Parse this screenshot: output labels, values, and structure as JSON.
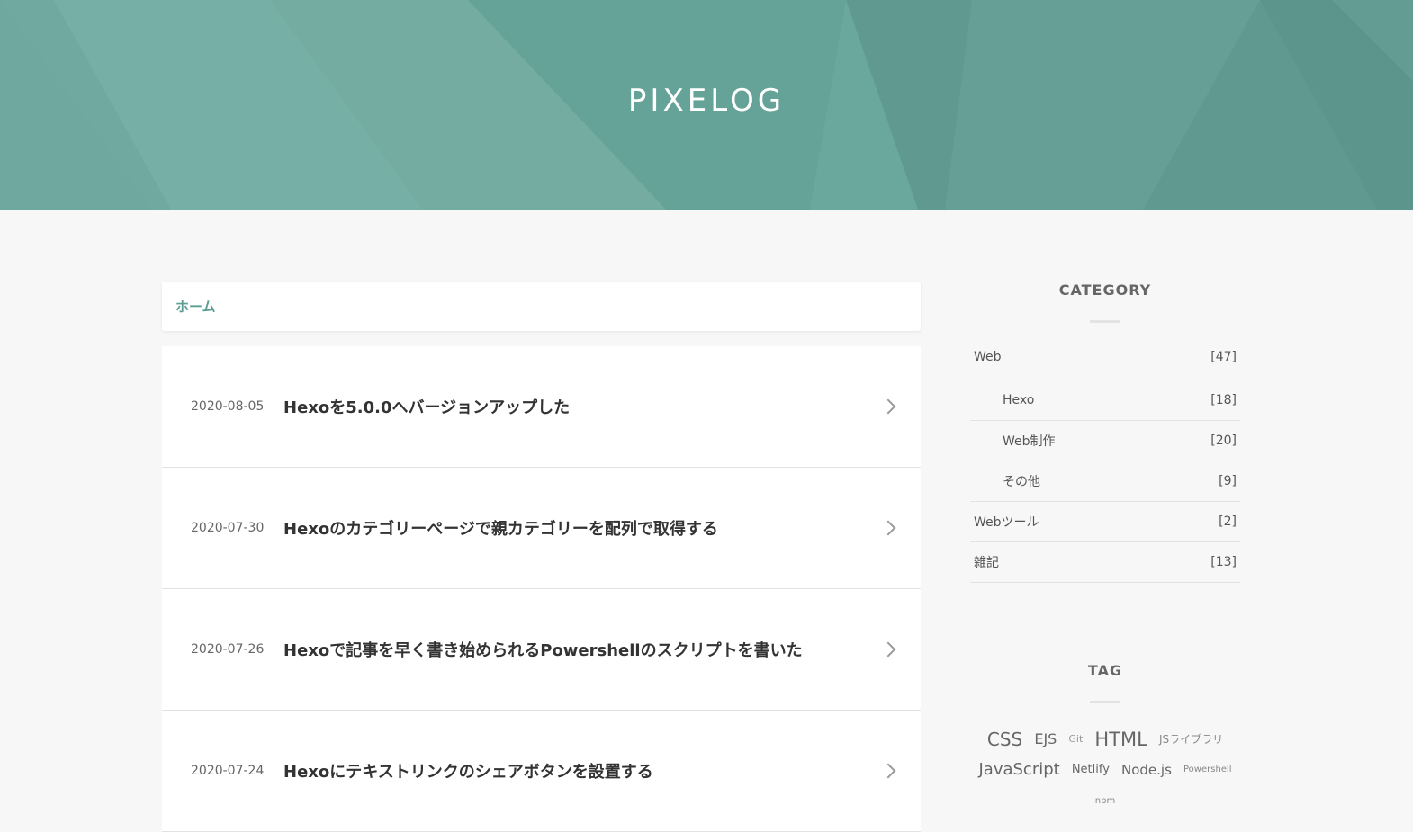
{
  "site": {
    "title": "PIXELOG"
  },
  "breadcrumb": {
    "home": "ホーム"
  },
  "posts": [
    {
      "date": "2020-08-05",
      "title": "Hexoを5.0.0へバージョンアップした"
    },
    {
      "date": "2020-07-30",
      "title": "Hexoのカテゴリーページで親カテゴリーを配列で取得する"
    },
    {
      "date": "2020-07-26",
      "title": "Hexoで記事を早く書き始められるPowershellのスクリプトを書いた"
    },
    {
      "date": "2020-07-24",
      "title": "Hexoにテキストリンクのシェアボタンを設置する"
    }
  ],
  "sidebar": {
    "category_title": "CATEGORY",
    "categories": [
      {
        "name": "Web",
        "count": "[47]"
      },
      {
        "name": "Hexo",
        "count": "[18]"
      },
      {
        "name": "Web制作",
        "count": "[20]"
      },
      {
        "name": "その他",
        "count": "[9]"
      },
      {
        "name": "Webツール",
        "count": "[2]"
      },
      {
        "name": "雑記",
        "count": "[13]"
      }
    ],
    "tag_title": "TAG",
    "tags": [
      {
        "name": "CSS"
      },
      {
        "name": "EJS"
      },
      {
        "name": "Git"
      },
      {
        "name": "HTML"
      },
      {
        "name": "JSライブラリ"
      },
      {
        "name": "JavaScript"
      },
      {
        "name": "Netlify"
      },
      {
        "name": "Node.js"
      },
      {
        "name": "Powershell"
      },
      {
        "name": "npm"
      }
    ]
  },
  "colors": {
    "header_bg": "#6aa89e",
    "accent": "#5b9f94",
    "page_bg": "#f7f7f7"
  }
}
